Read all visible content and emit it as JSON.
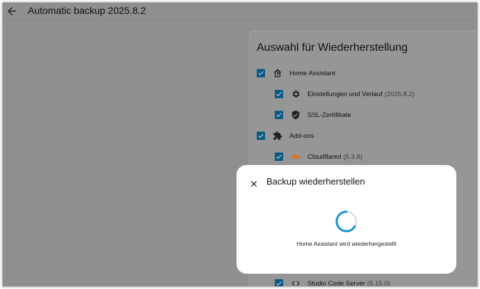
{
  "header": {
    "back_icon": "arrow-left-icon",
    "title": "Automatic backup 2025.8.2"
  },
  "selection": {
    "title": "Auswahl für Wiederherstellung",
    "items": [
      {
        "label": "Home Assistant",
        "version": "",
        "icon": "home-assistant-icon",
        "checked": true
      },
      {
        "label": "Einstellungen und Verlauf",
        "version": "(2025.8.2)",
        "icon": "gear-icon",
        "checked": true
      },
      {
        "label": "SSL-Zertifikate",
        "version": "",
        "icon": "shield-check-icon",
        "checked": true
      },
      {
        "label": "Add-ons",
        "version": "",
        "icon": "puzzle-icon",
        "checked": true
      },
      {
        "label": "Cloudflared",
        "version": "(5.3.8)",
        "icon": "cloudflare-icon",
        "checked": true
      },
      {
        "label": "Studio Code Server",
        "version": "(5.15.0)",
        "icon": "code-icon",
        "checked": true
      }
    ]
  },
  "dialog": {
    "title": "Backup wiederherstellen",
    "status": "Home Assistant wird wiederhergestellt",
    "close_icon": "close-icon",
    "spinner_icon": "loading-spinner-icon"
  },
  "colors": {
    "checkbox": "#0b5a86",
    "spinner": "#1796d2",
    "overlay": "#8f8f8f",
    "cloudflare": "#d9782b"
  }
}
